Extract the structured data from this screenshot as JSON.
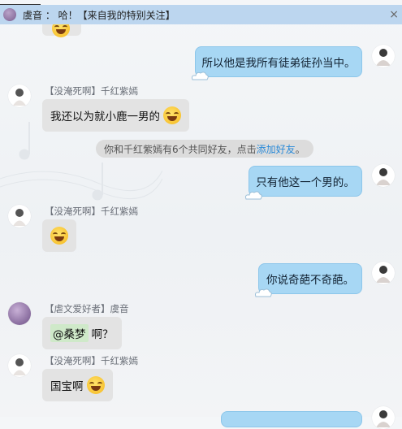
{
  "banner": {
    "text": "虞音 ： 哈！【来自我的特别关注】",
    "close_label": "×"
  },
  "messages": [
    {
      "side": "right",
      "text": "所以他是我所有徒弟徒孙当中。"
    },
    {
      "side": "left",
      "sender": "【没淹死啊】千红紫嫣",
      "text": "我还以为就小鹿一男的",
      "emoji": "laughing-tears"
    },
    {
      "side": "right",
      "text": "只有他这一个男的。"
    },
    {
      "side": "left",
      "sender": "【没淹死啊】千红紫嫣",
      "emoji": "laughing-tears"
    },
    {
      "side": "right",
      "text": "你说奇葩不奇葩。"
    },
    {
      "side": "left",
      "sender": "【虐文爱好者】虞音",
      "mention": "@桑梦",
      "text": "啊？"
    },
    {
      "side": "left",
      "sender": "【没淹死啊】千红紫嫣",
      "text": "国宝啊",
      "emoji": "laughing-tears"
    }
  ],
  "notice": {
    "text": "你和千红紫嫣有6个共同好友，点击",
    "link": "添加好友",
    "suffix": "。"
  },
  "colors": {
    "banner_bg": "#bcd6ef",
    "right_bubble": "#a7d7f4",
    "left_bubble": "#e3e3e3",
    "link": "#2a8ad8"
  }
}
